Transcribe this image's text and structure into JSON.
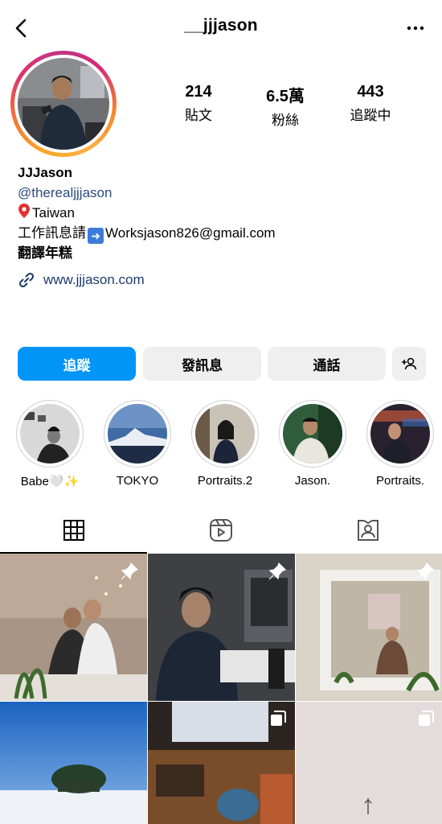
{
  "header": {
    "username": "__jjjason"
  },
  "stats": [
    {
      "value": "214",
      "label": "貼文"
    },
    {
      "value": "6.5萬",
      "label": "粉絲"
    },
    {
      "value": "443",
      "label": "追蹤中"
    }
  ],
  "bio": {
    "name": "JJJason",
    "handle": "@therealjjjason",
    "location": "Taiwan",
    "work_prefix": "工作訊息請",
    "work_email": "Worksjason826@gmail.com",
    "extra": "翻譯年糕",
    "link": "www.jjjason.com"
  },
  "buttons": {
    "follow": "追蹤",
    "message": "發訊息",
    "call": "通話"
  },
  "highlights": [
    {
      "label": "Babe🤍✨"
    },
    {
      "label": "TOKYO"
    },
    {
      "label": "Portraits.2"
    },
    {
      "label": "Jason."
    },
    {
      "label": "Portraits."
    }
  ],
  "tabs": [
    "grid-icon",
    "reels-icon",
    "tagged-icon"
  ],
  "colors": {
    "accent": "#0095f6",
    "handle": "#2a4b7c",
    "button_gray": "#efefef"
  }
}
